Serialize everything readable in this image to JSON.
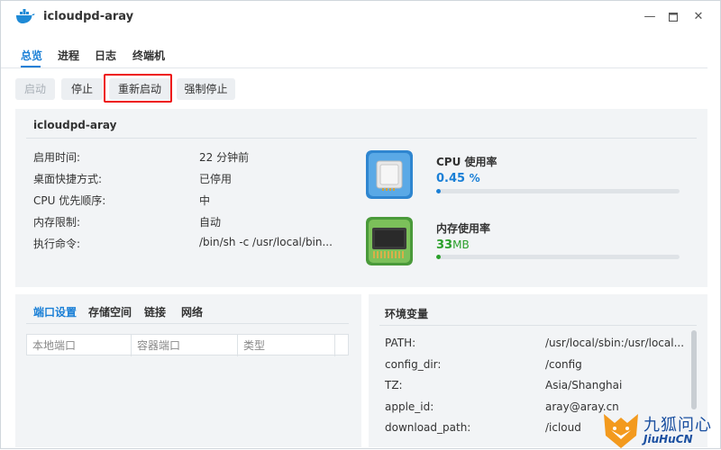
{
  "window": {
    "title": "icloudpd-aray"
  },
  "tabs": [
    {
      "label": "总览"
    },
    {
      "label": "进程"
    },
    {
      "label": "日志"
    },
    {
      "label": "终端机"
    }
  ],
  "toolbar": {
    "start": "启动",
    "stop": "停止",
    "restart": "重新启动",
    "force_stop": "强制停止"
  },
  "overview": {
    "name": "icloudpd-aray",
    "rows": [
      {
        "label": "启用时间:",
        "value": "22 分钟前"
      },
      {
        "label": "桌面快捷方式:",
        "value": "已停用"
      },
      {
        "label": "CPU 优先顺序:",
        "value": "中"
      },
      {
        "label": "内存限制:",
        "value": "自动"
      },
      {
        "label": "执行命令:",
        "value": "/bin/sh -c /usr/local/bin..."
      }
    ],
    "cpu": {
      "title": "CPU 使用率",
      "value": "0.45",
      "unit": "%",
      "fraction": 0.0045,
      "color": "#1a7fd6"
    },
    "memory": {
      "title": "内存使用率",
      "value": "33",
      "unit": "MB",
      "fraction": 0.01,
      "color": "#2aa02a"
    }
  },
  "ports": {
    "tabs": [
      {
        "label": "端口设置"
      },
      {
        "label": "存储空间"
      },
      {
        "label": "链接"
      },
      {
        "label": "网络"
      }
    ],
    "columns": [
      "本地端口",
      "容器端口",
      "类型"
    ]
  },
  "env": {
    "title": "环境变量",
    "rows": [
      {
        "key": "PATH:",
        "value": "/usr/local/sbin:/usr/local..."
      },
      {
        "key": "config_dir:",
        "value": "/config"
      },
      {
        "key": "TZ:",
        "value": "Asia/Shanghai"
      },
      {
        "key": "apple_id:",
        "value": "aray@aray.cn"
      },
      {
        "key": "download_path:",
        "value": "/icloud"
      }
    ]
  },
  "watermark": {
    "text_cn": "九狐问心",
    "text_en": "JiuHuCN"
  }
}
